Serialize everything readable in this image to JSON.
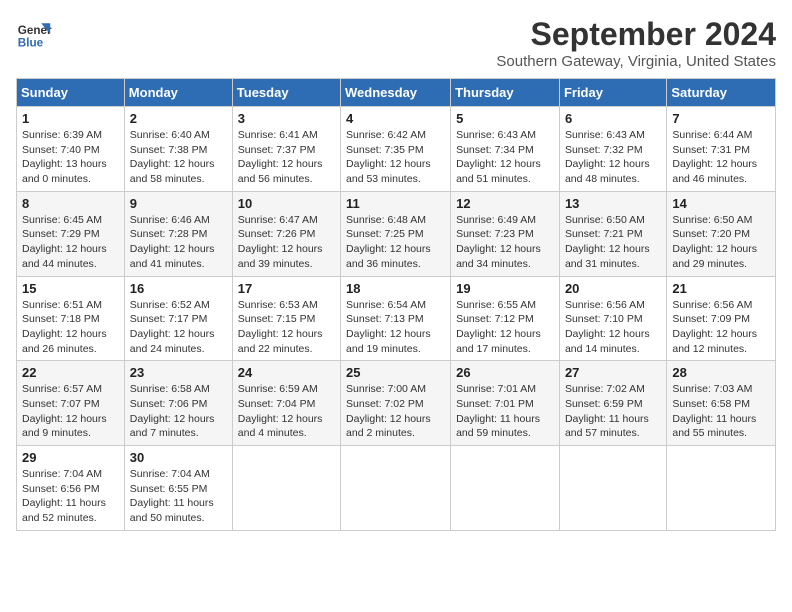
{
  "header": {
    "logo_line1": "General",
    "logo_line2": "Blue",
    "month": "September 2024",
    "location": "Southern Gateway, Virginia, United States"
  },
  "weekdays": [
    "Sunday",
    "Monday",
    "Tuesday",
    "Wednesday",
    "Thursday",
    "Friday",
    "Saturday"
  ],
  "weeks": [
    [
      {
        "day": "1",
        "sunrise": "6:39 AM",
        "sunset": "7:40 PM",
        "daylight": "13 hours and 0 minutes."
      },
      {
        "day": "2",
        "sunrise": "6:40 AM",
        "sunset": "7:38 PM",
        "daylight": "12 hours and 58 minutes."
      },
      {
        "day": "3",
        "sunrise": "6:41 AM",
        "sunset": "7:37 PM",
        "daylight": "12 hours and 56 minutes."
      },
      {
        "day": "4",
        "sunrise": "6:42 AM",
        "sunset": "7:35 PM",
        "daylight": "12 hours and 53 minutes."
      },
      {
        "day": "5",
        "sunrise": "6:43 AM",
        "sunset": "7:34 PM",
        "daylight": "12 hours and 51 minutes."
      },
      {
        "day": "6",
        "sunrise": "6:43 AM",
        "sunset": "7:32 PM",
        "daylight": "12 hours and 48 minutes."
      },
      {
        "day": "7",
        "sunrise": "6:44 AM",
        "sunset": "7:31 PM",
        "daylight": "12 hours and 46 minutes."
      }
    ],
    [
      {
        "day": "8",
        "sunrise": "6:45 AM",
        "sunset": "7:29 PM",
        "daylight": "12 hours and 44 minutes."
      },
      {
        "day": "9",
        "sunrise": "6:46 AM",
        "sunset": "7:28 PM",
        "daylight": "12 hours and 41 minutes."
      },
      {
        "day": "10",
        "sunrise": "6:47 AM",
        "sunset": "7:26 PM",
        "daylight": "12 hours and 39 minutes."
      },
      {
        "day": "11",
        "sunrise": "6:48 AM",
        "sunset": "7:25 PM",
        "daylight": "12 hours and 36 minutes."
      },
      {
        "day": "12",
        "sunrise": "6:49 AM",
        "sunset": "7:23 PM",
        "daylight": "12 hours and 34 minutes."
      },
      {
        "day": "13",
        "sunrise": "6:50 AM",
        "sunset": "7:21 PM",
        "daylight": "12 hours and 31 minutes."
      },
      {
        "day": "14",
        "sunrise": "6:50 AM",
        "sunset": "7:20 PM",
        "daylight": "12 hours and 29 minutes."
      }
    ],
    [
      {
        "day": "15",
        "sunrise": "6:51 AM",
        "sunset": "7:18 PM",
        "daylight": "12 hours and 26 minutes."
      },
      {
        "day": "16",
        "sunrise": "6:52 AM",
        "sunset": "7:17 PM",
        "daylight": "12 hours and 24 minutes."
      },
      {
        "day": "17",
        "sunrise": "6:53 AM",
        "sunset": "7:15 PM",
        "daylight": "12 hours and 22 minutes."
      },
      {
        "day": "18",
        "sunrise": "6:54 AM",
        "sunset": "7:13 PM",
        "daylight": "12 hours and 19 minutes."
      },
      {
        "day": "19",
        "sunrise": "6:55 AM",
        "sunset": "7:12 PM",
        "daylight": "12 hours and 17 minutes."
      },
      {
        "day": "20",
        "sunrise": "6:56 AM",
        "sunset": "7:10 PM",
        "daylight": "12 hours and 14 minutes."
      },
      {
        "day": "21",
        "sunrise": "6:56 AM",
        "sunset": "7:09 PM",
        "daylight": "12 hours and 12 minutes."
      }
    ],
    [
      {
        "day": "22",
        "sunrise": "6:57 AM",
        "sunset": "7:07 PM",
        "daylight": "12 hours and 9 minutes."
      },
      {
        "day": "23",
        "sunrise": "6:58 AM",
        "sunset": "7:06 PM",
        "daylight": "12 hours and 7 minutes."
      },
      {
        "day": "24",
        "sunrise": "6:59 AM",
        "sunset": "7:04 PM",
        "daylight": "12 hours and 4 minutes."
      },
      {
        "day": "25",
        "sunrise": "7:00 AM",
        "sunset": "7:02 PM",
        "daylight": "12 hours and 2 minutes."
      },
      {
        "day": "26",
        "sunrise": "7:01 AM",
        "sunset": "7:01 PM",
        "daylight": "11 hours and 59 minutes."
      },
      {
        "day": "27",
        "sunrise": "7:02 AM",
        "sunset": "6:59 PM",
        "daylight": "11 hours and 57 minutes."
      },
      {
        "day": "28",
        "sunrise": "7:03 AM",
        "sunset": "6:58 PM",
        "daylight": "11 hours and 55 minutes."
      }
    ],
    [
      {
        "day": "29",
        "sunrise": "7:04 AM",
        "sunset": "6:56 PM",
        "daylight": "11 hours and 52 minutes."
      },
      {
        "day": "30",
        "sunrise": "7:04 AM",
        "sunset": "6:55 PM",
        "daylight": "11 hours and 50 minutes."
      },
      null,
      null,
      null,
      null,
      null
    ]
  ]
}
